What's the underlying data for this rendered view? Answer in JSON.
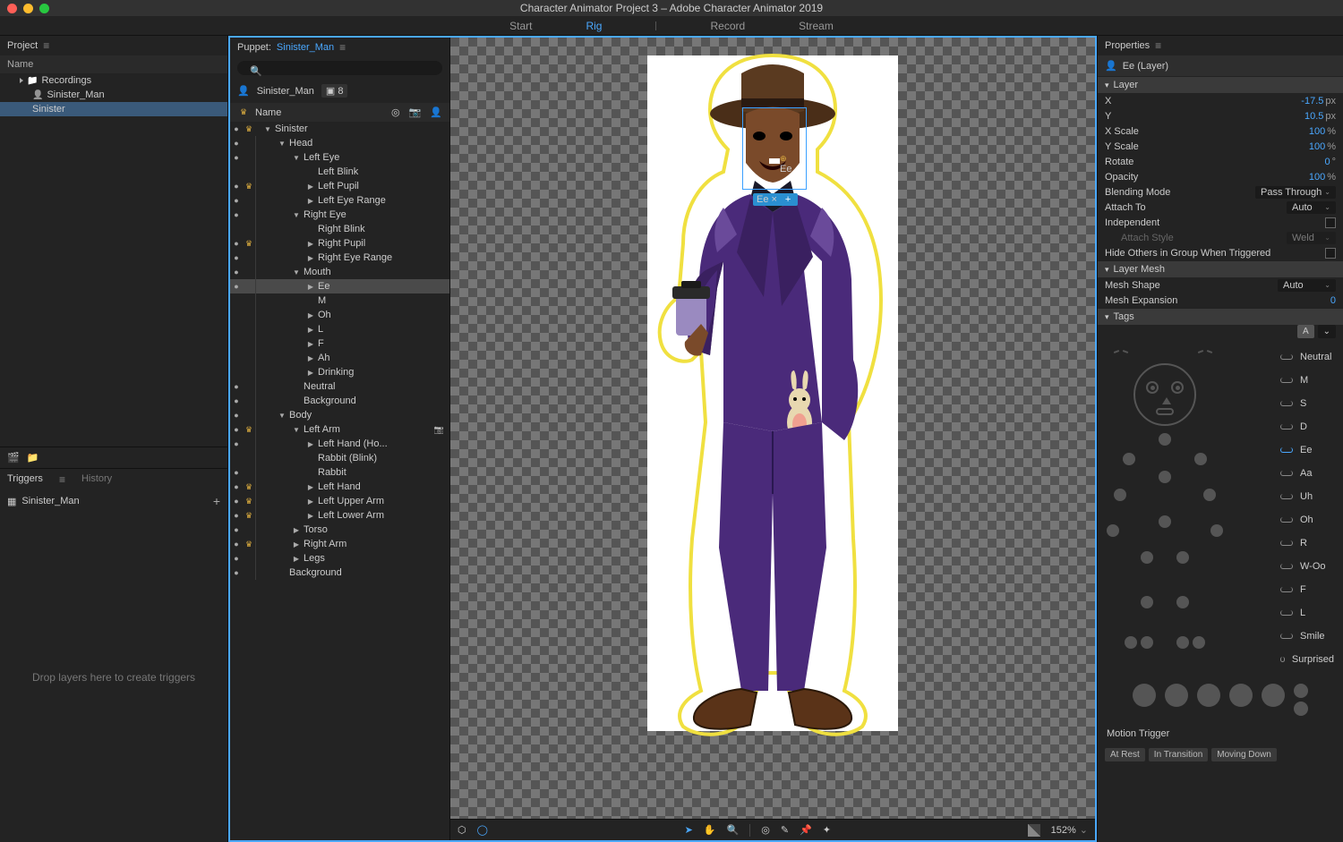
{
  "title": "Character Animator Project 3 – Adobe Character Animator 2019",
  "traffic": {
    "close": "#ff5f57",
    "min": "#febc2e",
    "max": "#28c840"
  },
  "topTabs": {
    "start": "Start",
    "rig": "Rig",
    "record": "Record",
    "stream": "Stream"
  },
  "projectPanel": {
    "title": "Project",
    "nameHeader": "Name",
    "items": [
      {
        "type": "folder",
        "label": "Recordings",
        "indent": 1
      },
      {
        "type": "puppet",
        "label": "Sinister_Man",
        "indent": 1
      },
      {
        "type": "puppet",
        "label": "Sinister",
        "indent": 1,
        "selected": true
      }
    ]
  },
  "triggersPanel": {
    "tabs": {
      "triggers": "Triggers",
      "history": "History"
    },
    "item": "Sinister_Man",
    "dropHint": "Drop layers here to create triggers"
  },
  "puppetPanel": {
    "label": "Puppet:",
    "name": "Sinister_Man",
    "puppetRow": "Sinister_Man",
    "puppetBadge": "8",
    "searchPlaceholder": "",
    "nameHeader": "Name",
    "layers": [
      {
        "d": 0,
        "tw": "open",
        "label": "Sinister",
        "root": true,
        "crown": true,
        "eye": true
      },
      {
        "d": 1,
        "tw": "open",
        "label": "Head",
        "eye": true
      },
      {
        "d": 2,
        "tw": "open",
        "label": "Left Eye",
        "eye": true
      },
      {
        "d": 3,
        "label": "Left Blink"
      },
      {
        "d": 3,
        "tw": "closed",
        "label": "Left Pupil",
        "eye": true,
        "crown": true
      },
      {
        "d": 3,
        "tw": "closed",
        "label": "Left Eye Range",
        "eye": true
      },
      {
        "d": 2,
        "tw": "open",
        "label": "Right Eye",
        "eye": true
      },
      {
        "d": 3,
        "label": "Right Blink"
      },
      {
        "d": 3,
        "tw": "closed",
        "label": "Right Pupil",
        "eye": true,
        "crown": true
      },
      {
        "d": 3,
        "tw": "closed",
        "label": "Right Eye Range",
        "eye": true
      },
      {
        "d": 2,
        "tw": "open",
        "label": "Mouth",
        "eye": true
      },
      {
        "d": 3,
        "tw": "closed",
        "label": "Ee",
        "eye": true,
        "sel": true
      },
      {
        "d": 3,
        "label": "M"
      },
      {
        "d": 3,
        "tw": "closed",
        "label": "Oh"
      },
      {
        "d": 3,
        "tw": "closed",
        "label": "L"
      },
      {
        "d": 3,
        "tw": "closed",
        "label": "F"
      },
      {
        "d": 3,
        "tw": "closed",
        "label": "Ah"
      },
      {
        "d": 3,
        "tw": "closed",
        "label": "Drinking"
      },
      {
        "d": 2,
        "label": "Neutral",
        "eye": true
      },
      {
        "d": 2,
        "label": "Background",
        "eye": true
      },
      {
        "d": 1,
        "tw": "open",
        "label": "Body",
        "eye": true
      },
      {
        "d": 2,
        "tw": "open",
        "label": "Left Arm",
        "eye": true,
        "crown": true,
        "cam": true
      },
      {
        "d": 3,
        "tw": "closed",
        "label": "Left Hand (Ho...",
        "eye": true
      },
      {
        "d": 3,
        "label": "Rabbit (Blink)"
      },
      {
        "d": 3,
        "label": "Rabbit",
        "eye": true
      },
      {
        "d": 3,
        "tw": "closed",
        "label": "Left Hand",
        "eye": true,
        "crown": true
      },
      {
        "d": 3,
        "tw": "closed",
        "label": "Left Upper Arm",
        "eye": true,
        "crown": true
      },
      {
        "d": 3,
        "tw": "closed",
        "label": "Left Lower Arm",
        "eye": true,
        "crown": true
      },
      {
        "d": 2,
        "tw": "closed",
        "label": "Torso",
        "eye": true
      },
      {
        "d": 2,
        "tw": "closed",
        "label": "Right Arm",
        "eye": true,
        "crown": true
      },
      {
        "d": 2,
        "tw": "closed",
        "label": "Legs",
        "eye": true
      },
      {
        "d": 1,
        "label": "Background",
        "eye": true
      }
    ]
  },
  "viewport": {
    "overlayLabel": "Ee",
    "zoom": "152%"
  },
  "properties": {
    "title": "Properties",
    "layerName": "Ee (Layer)",
    "sections": {
      "layer": "Layer",
      "layerMesh": "Layer Mesh",
      "tags": "Tags"
    },
    "layer": {
      "x": {
        "label": "X",
        "val": "-17.5",
        "unit": "px"
      },
      "y": {
        "label": "Y",
        "val": "10.5",
        "unit": "px"
      },
      "xscale": {
        "label": "X Scale",
        "val": "100",
        "unit": "%"
      },
      "yscale": {
        "label": "Y Scale",
        "val": "100",
        "unit": "%"
      },
      "rotate": {
        "label": "Rotate",
        "val": "0",
        "unit": "°"
      },
      "opacity": {
        "label": "Opacity",
        "val": "100",
        "unit": "%"
      },
      "blending": {
        "label": "Blending Mode",
        "val": "Pass Through"
      },
      "attach": {
        "label": "Attach To",
        "val": "Auto"
      },
      "independent": {
        "label": "Independent"
      },
      "attachStyle": {
        "label": "Attach Style",
        "val": "Weld"
      },
      "hideOthers": {
        "label": "Hide Others in Group When Triggered"
      }
    },
    "layerMesh": {
      "shape": {
        "label": "Mesh Shape",
        "val": "Auto"
      },
      "expansion": {
        "label": "Mesh Expansion",
        "val": "0"
      }
    },
    "tagsToggle": {
      "a": "A",
      "b": "⌄"
    },
    "visemes": [
      "Neutral",
      "M",
      "S",
      "D",
      "Ee",
      "Aa",
      "Uh",
      "Oh",
      "R",
      "W-Oo",
      "F",
      "L",
      "Smile",
      "Surprised"
    ],
    "motionTrigger": "Motion Trigger",
    "pills": [
      "At Rest",
      "In Transition",
      "Moving Down"
    ]
  }
}
